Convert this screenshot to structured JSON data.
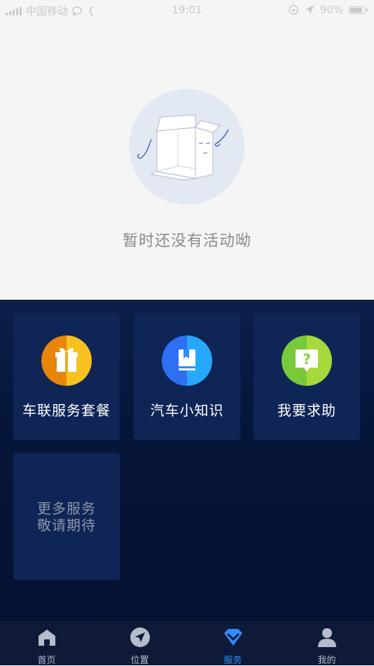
{
  "status_bar": {
    "carrier": "中国移动",
    "time": "19:01",
    "battery": "90%"
  },
  "empty_state": {
    "message": "暂时还没有活动呦"
  },
  "services": [
    {
      "label": "车联服务套餐",
      "icon": "gift-icon",
      "color_left": "#e8860c",
      "color_right": "#f7c21f"
    },
    {
      "label": "汽车小知识",
      "icon": "book-icon",
      "color_left": "#2f6ff2",
      "color_right": "#27a8ff"
    },
    {
      "label": "我要求助",
      "icon": "help-icon",
      "color_left": "#79c93a",
      "color_right": "#a7d93c"
    }
  ],
  "more_services": {
    "line1": "更多服务",
    "line2": "敬请期待"
  },
  "tabs": [
    {
      "label": "首页",
      "icon": "home-icon"
    },
    {
      "label": "位置",
      "icon": "location-icon"
    },
    {
      "label": "服务",
      "icon": "service-icon",
      "active": true
    },
    {
      "label": "我的",
      "icon": "user-icon"
    }
  ],
  "colors": {
    "active_tab": "#2f8cff",
    "inactive_tab": "#b5bccb",
    "services_bg": "#06163a",
    "card_bg": "#0e2556"
  }
}
